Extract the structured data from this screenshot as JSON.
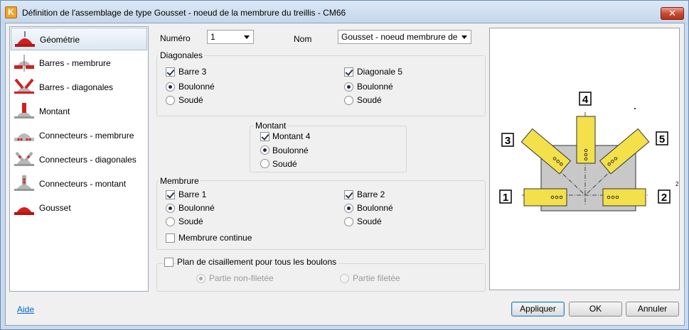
{
  "window": {
    "title": "Définition de l'assemblage de type Gousset - noeud de la membrure du treillis - CM66",
    "close_glyph": "✕",
    "app_icon_letter": "K"
  },
  "sidebar": {
    "items": [
      {
        "label": "Géométrie",
        "icon": "gusset-geometry-icon",
        "selected": true
      },
      {
        "label": "Barres - membrure",
        "icon": "chord-bars-icon"
      },
      {
        "label": "Barres - diagonales",
        "icon": "diagonal-bars-icon"
      },
      {
        "label": "Montant",
        "icon": "vertical-member-icon"
      },
      {
        "label": "Connecteurs - membrure",
        "icon": "chord-connectors-icon"
      },
      {
        "label": "Connecteurs - diagonales",
        "icon": "diagonal-connectors-icon"
      },
      {
        "label": "Connecteurs - montant",
        "icon": "vertical-connectors-icon"
      },
      {
        "label": "Gousset",
        "icon": "gusset-plate-icon"
      }
    ]
  },
  "form": {
    "numero_label": "Numéro",
    "numero_value": "1",
    "nom_label": "Nom",
    "nom_value": "Gousset - noeud membrure de treilli",
    "diagonales": {
      "title": "Diagonales",
      "left_check": "Barre 3",
      "left_bolted": "Boulonné",
      "left_welded": "Soudé",
      "right_check": "Diagonale 5",
      "right_bolted": "Boulonné",
      "right_welded": "Soudé"
    },
    "montant": {
      "title": "Montant",
      "check": "Montant 4",
      "bolted": "Boulonné",
      "welded": "Soudé"
    },
    "membrure": {
      "title": "Membrure",
      "left_check": "Barre 1",
      "left_bolted": "Boulonné",
      "left_welded": "Soudé",
      "right_check": "Barre 2",
      "right_bolted": "Boulonné",
      "right_welded": "Soudé",
      "continuous": "Membrure continue"
    },
    "shear": {
      "check": "Plan de cisaillement pour tous les boulons",
      "non_threaded": "Partie non-filetée",
      "threaded": "Partie filetée"
    }
  },
  "preview": {
    "labels": [
      "1",
      "2",
      "3",
      "4",
      "5"
    ],
    "superscript": "2",
    "colors": {
      "member": "#f3e04a",
      "plate": "#c8c8c8"
    }
  },
  "footer": {
    "help": "Aide",
    "apply": "Appliquer",
    "ok": "OK",
    "cancel": "Annuler"
  },
  "colors": {
    "icon_red": "#d02020",
    "titlebar": "#c9daee",
    "link": "#0066cc"
  }
}
